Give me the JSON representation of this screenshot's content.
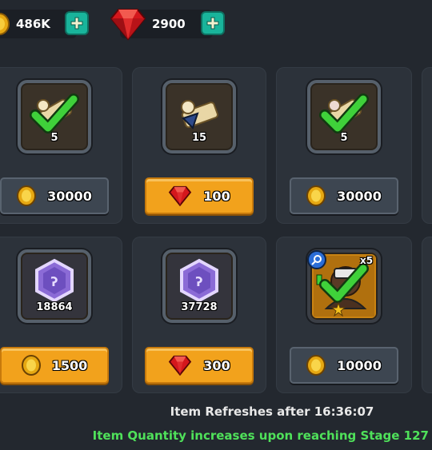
{
  "currency": {
    "gold_amount": "486K",
    "gem_amount": "2900",
    "gold_icon": "coin-icon",
    "gem_icon": "ruby-icon"
  },
  "items": [
    {
      "quantity": "5",
      "icon": "scroll-icon",
      "purchased": true,
      "price": "30000",
      "price_currency": "coin",
      "button_style": "dark"
    },
    {
      "quantity": "15",
      "icon": "scroll-icon",
      "purchased": false,
      "price": "100",
      "price_currency": "ruby",
      "button_style": "orange"
    },
    {
      "quantity": "5",
      "icon": "scroll-icon",
      "purchased": true,
      "price": "30000",
      "price_currency": "coin",
      "button_style": "dark"
    },
    {
      "quantity": "18864",
      "icon": "purple-rune-stone-icon",
      "purchased": false,
      "price": "1500",
      "price_currency": "coin",
      "button_style": "orange"
    },
    {
      "quantity": "37728",
      "icon": "purple-rune-stone-icon",
      "purchased": false,
      "price": "300",
      "price_currency": "ruby",
      "button_style": "orange"
    },
    {
      "quantity": "",
      "icon": "hero-portrait-icon",
      "purchased": true,
      "multiplier": "x5",
      "stars": 1,
      "price": "10000",
      "price_currency": "coin",
      "button_style": "dark"
    }
  ],
  "footer": {
    "refresh_text": "Item Refreshes after 16:36:07",
    "quantity_note": "Item Quantity increases upon reaching Stage 127"
  },
  "colors": {
    "background": "#23282f",
    "card": "#2c323a",
    "orange_button": "#f2a21c",
    "dark_button": "#3d4651",
    "plus_button": "#19b49b",
    "check_green": "#3fd13a",
    "note_green": "#4fe15a"
  }
}
